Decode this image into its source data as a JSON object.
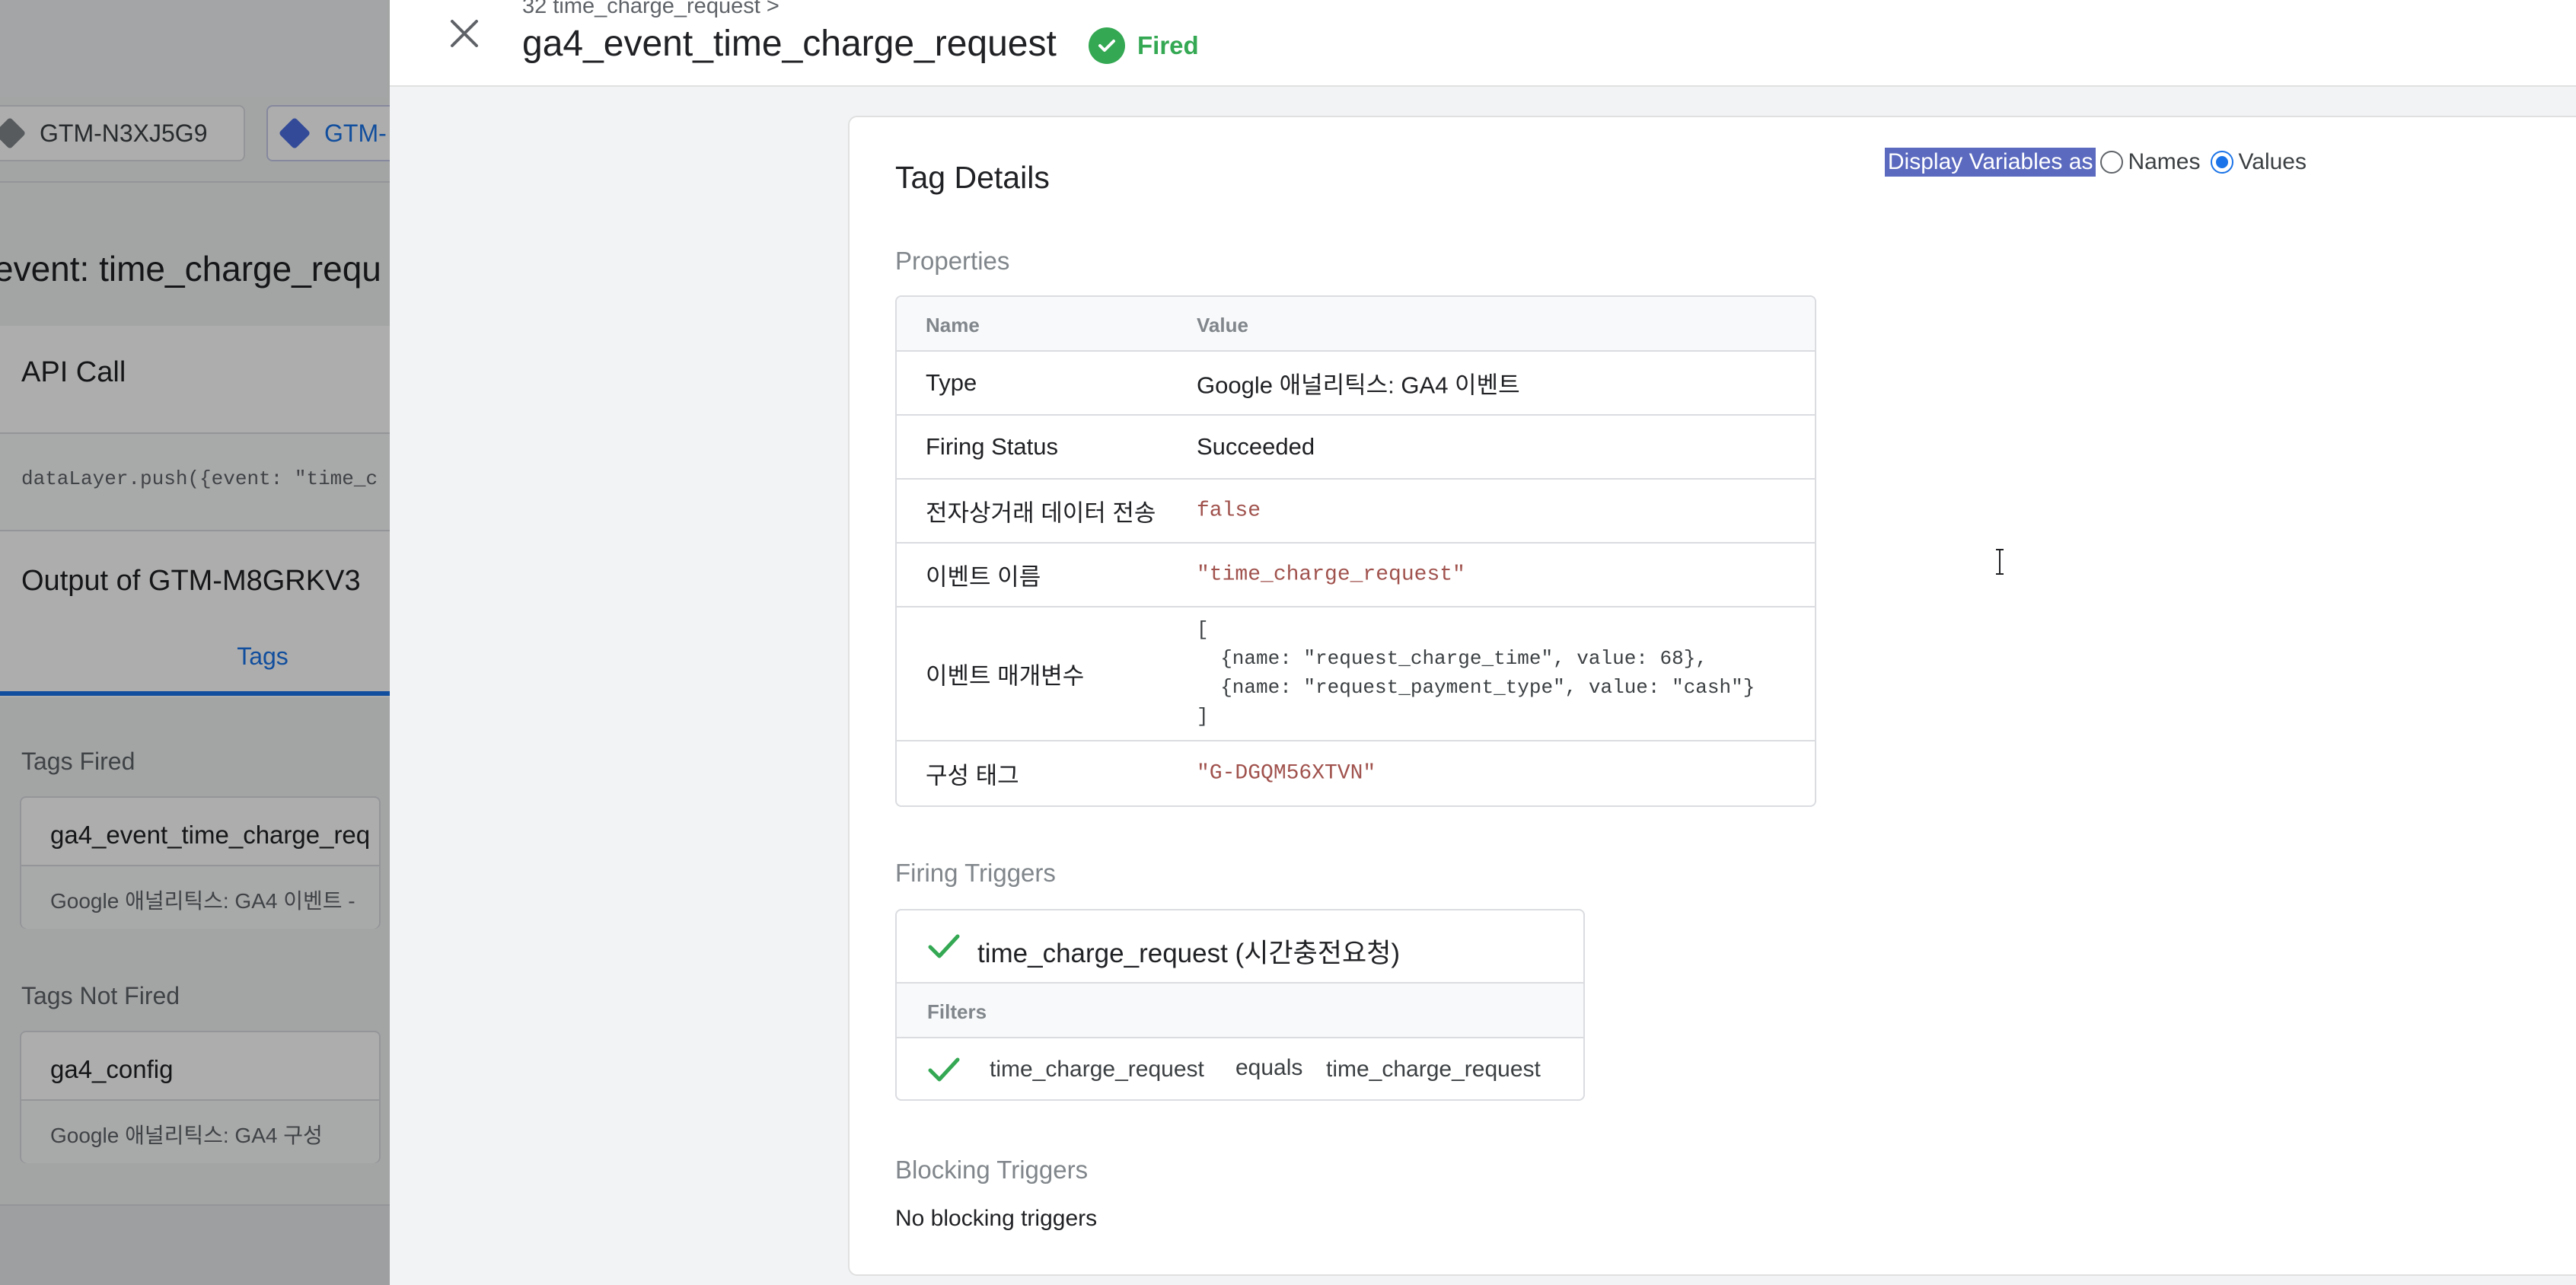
{
  "background": {
    "chips": [
      "GTM-N3XJ5G9",
      "GTM-"
    ],
    "event_title": "event: time_charge_requ",
    "api_call": {
      "title": "API Call",
      "code": "dataLayer.push({event: \"time_c"
    },
    "output": {
      "title": "Output of GTM-M8GRKV3",
      "tab": "Tags"
    },
    "tags_fired": {
      "label": "Tags Fired",
      "name": "ga4_event_time_charge_req",
      "subtitle": "Google 애널리틱스: GA4 이벤트 -"
    },
    "tags_not_fired": {
      "label": "Tags Not Fired",
      "name": "ga4_config",
      "subtitle": "Google 애널리틱스: GA4 구성"
    }
  },
  "drawer": {
    "breadcrumb": "32 time_charge_request >",
    "title": "ga4_event_time_charge_request",
    "status": "Fired",
    "panel_title": "Tag Details",
    "display_vars": {
      "label": "Display Variables as",
      "names": "Names",
      "values": "Values",
      "selected": "Values"
    },
    "properties_label": "Properties",
    "properties": {
      "headers": [
        "Name",
        "Value"
      ],
      "rows": [
        {
          "name": "Type",
          "value": "Google 애널리틱스: GA4 이벤트"
        },
        {
          "name": "Firing Status",
          "value": "Succeeded"
        },
        {
          "name": "전자상거래 데이터 전송",
          "value": "false"
        },
        {
          "name": "이벤트 이름",
          "value": "\"time_charge_request\""
        },
        {
          "name": "이벤트 매개변수",
          "lines": [
            "[",
            "  {name: \"request_charge_time\", value: 68},",
            "  {name: \"request_payment_type\", value: \"cash\"}",
            "]"
          ]
        },
        {
          "name": "구성 태그",
          "value": "\"G-DGQM56XTVN\""
        }
      ]
    },
    "firing_triggers_label": "Firing Triggers",
    "trigger": {
      "name": "time_charge_request (시간충전요청)",
      "filters_label": "Filters",
      "filter": {
        "variable": "time_charge_request",
        "operator": "equals",
        "value": "time_charge_request"
      }
    },
    "blocking_triggers_label": "Blocking Triggers",
    "blocking_triggers_text": "No blocking triggers"
  },
  "colors": {
    "fired_green": "#34a853",
    "accent_blue": "#1a73e8",
    "code_string": "#a0524d"
  },
  "icons": [
    "close-icon",
    "check-circle-icon",
    "check-icon",
    "gtm-diamond-icon",
    "ibeam-cursor-icon"
  ]
}
